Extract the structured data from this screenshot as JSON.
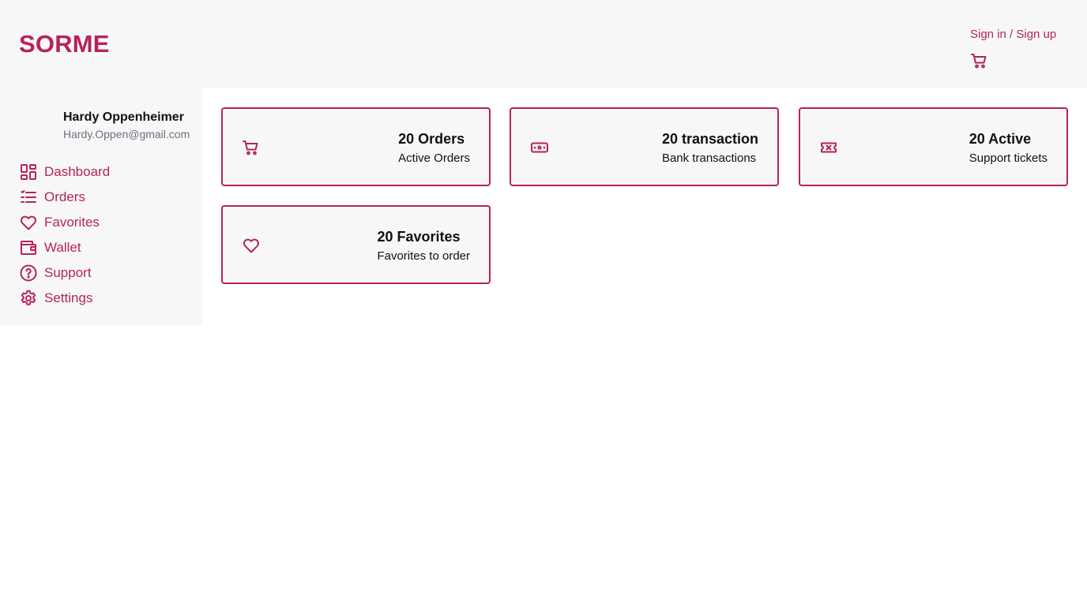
{
  "brand": {
    "name": "SORME",
    "accent_color": "#b5235c"
  },
  "header": {
    "auth_link": "Sign in / Sign up",
    "cart_icon": "cart-icon"
  },
  "user": {
    "name": "Hardy Oppenheimer",
    "email": "Hardy.Oppen@gmail.com"
  },
  "sidebar": {
    "items": [
      {
        "label": "Dashboard",
        "icon": "dashboard-icon"
      },
      {
        "label": "Orders",
        "icon": "list-icon"
      },
      {
        "label": "Favorites",
        "icon": "heart-icon"
      },
      {
        "label": "Wallet",
        "icon": "wallet-icon"
      },
      {
        "label": "Support",
        "icon": "help-circle-icon"
      },
      {
        "label": "Settings",
        "icon": "gear-icon"
      }
    ]
  },
  "cards": [
    {
      "title": "20 Orders",
      "subtitle": "Active Orders",
      "icon": "cart-icon"
    },
    {
      "title": "20 transaction",
      "subtitle": "Bank transactions",
      "icon": "cash-icon"
    },
    {
      "title": "20 Active",
      "subtitle": "Support tickets",
      "icon": "ticket-icon"
    },
    {
      "title": "20 Favorites",
      "subtitle": "Favorites to order",
      "icon": "heart-icon"
    }
  ]
}
